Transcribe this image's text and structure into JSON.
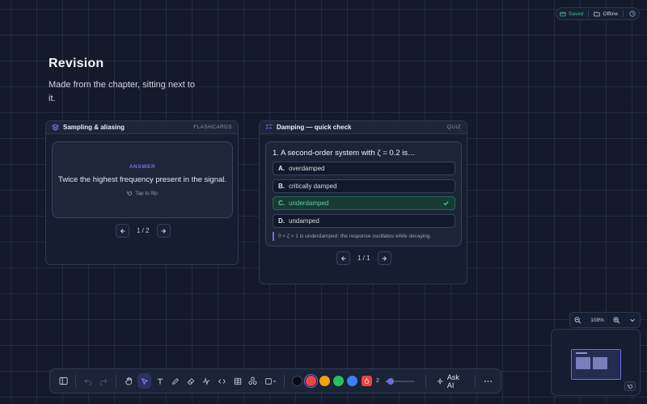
{
  "status": {
    "saved": "Saved",
    "offline": "Offline"
  },
  "revision": {
    "title": "Revision",
    "subtitle": "Made from the chapter, sitting next to it."
  },
  "flashcards": {
    "title": "Sampling & aliasing",
    "tag": "FLASHCARDS",
    "side_label": "ANSWER",
    "answer": "Twice the highest frequency present in the signal.",
    "flip_hint": "Tap to flip",
    "page": "1 / 2"
  },
  "quiz": {
    "title": "Damping — quick check",
    "tag": "QUIZ",
    "question": "1. A second-order system with ζ = 0.2 is…",
    "options": [
      {
        "letter": "A.",
        "text": "overdamped"
      },
      {
        "letter": "B.",
        "text": "critically damped"
      },
      {
        "letter": "C.",
        "text": "underdamped"
      },
      {
        "letter": "D.",
        "text": "undamped"
      }
    ],
    "correct_index": 2,
    "explanation": "0 < ζ < 1 is underdamped: the response oscillates while decaying.",
    "page": "1 / 1"
  },
  "zoom": {
    "level": "108%"
  },
  "toolbar": {
    "colors": [
      "#0b0d12",
      "#ef4444",
      "#f59e0b",
      "#22c55e",
      "#3b82f6"
    ],
    "selected_color_index": 1,
    "stroke_width": "2",
    "stroke_slider_fraction": 0.1,
    "ask_ai": "Ask AI"
  }
}
